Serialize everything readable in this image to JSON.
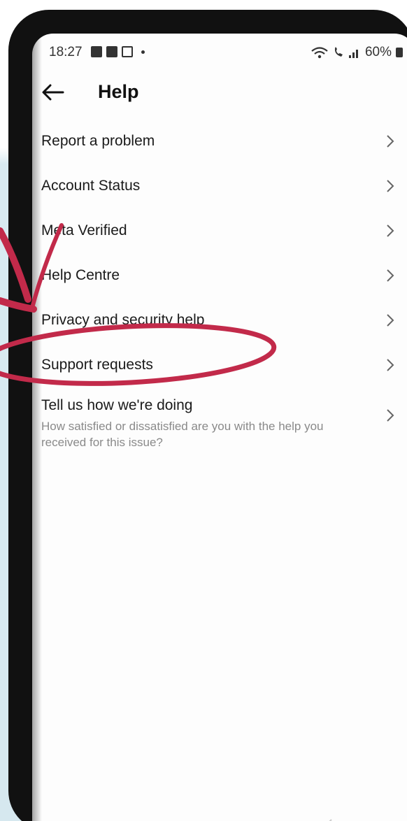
{
  "status_bar": {
    "time": "18:27",
    "battery": "60%"
  },
  "header": {
    "title": "Help"
  },
  "menu": {
    "items": [
      {
        "label": "Report a problem"
      },
      {
        "label": "Account Status"
      },
      {
        "label": "Meta Verified"
      },
      {
        "label": "Help Centre"
      },
      {
        "label": "Privacy and security help"
      },
      {
        "label": "Support requests"
      },
      {
        "label": "Tell us how we're doing",
        "sublabel": "How satisfied or dissatisfied are you with the help you received for this issue?"
      }
    ]
  },
  "colors": {
    "annotation": "#c22a4a",
    "text": "#1a1a1a",
    "muted": "#8a8a8a",
    "backdrop": "#d6e8ef"
  }
}
